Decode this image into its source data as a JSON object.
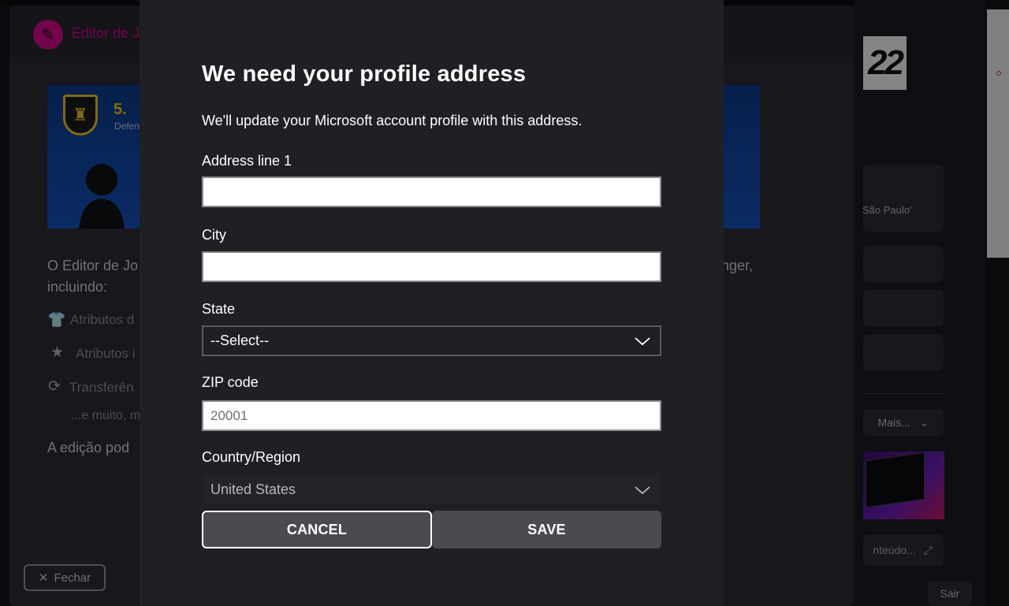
{
  "background": {
    "editor_title": "Editor de J",
    "player_number": "5.",
    "player_position": "Defen",
    "intro_line1": "O Editor de Jo",
    "intro_line1_suffix": "nger,",
    "intro_line2": "incluindo:",
    "list_items": [
      {
        "icon": "shirt-icon",
        "label": "Atributos d"
      },
      {
        "icon": "star-icon",
        "label": "Atributos i"
      },
      {
        "icon": "sync-icon",
        "label": "Transferên"
      }
    ],
    "more_text": "...e muito, m",
    "edit_note": "A edição pod",
    "close_button": "Fechar",
    "year_badge": "22",
    "club_hint": "São Paulo'",
    "more_dropdown": "Mais...",
    "content_link": "nteúdo...",
    "exit_button": "Sair"
  },
  "dialog": {
    "title": "We need your profile address",
    "description": "We'll update your Microsoft account profile with this address.",
    "address_label": "Address line 1",
    "address_value": "",
    "city_label": "City",
    "city_value": "",
    "state_label": "State",
    "state_value": "--Select--",
    "zip_label": "ZIP code",
    "zip_placeholder": "20001",
    "country_label": "Country/Region",
    "country_value": "United States",
    "cancel_label": "CANCEL",
    "save_label": "SAVE"
  }
}
